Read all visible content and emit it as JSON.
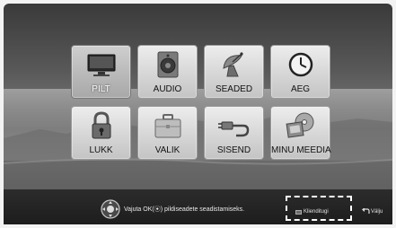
{
  "menu": {
    "tiles": [
      {
        "label": "PILT",
        "icon": "tv-icon",
        "selected": true
      },
      {
        "label": "AUDIO",
        "icon": "speaker-icon",
        "selected": false
      },
      {
        "label": "SEADED",
        "icon": "satellite-dish-icon",
        "selected": false
      },
      {
        "label": "AEG",
        "icon": "clock-icon",
        "selected": false
      },
      {
        "label": "LUKK",
        "icon": "padlock-icon",
        "selected": false
      },
      {
        "label": "VALIK",
        "icon": "briefcase-icon",
        "selected": false
      },
      {
        "label": "SISEND",
        "icon": "input-plug-icon",
        "selected": false
      },
      {
        "label": "MINU MEEDIA",
        "icon": "media-icon",
        "selected": false
      }
    ]
  },
  "footer": {
    "hint": "Vajuta OK(⦿) pildiseadete seadistamiseks.",
    "service": "Klienditugi",
    "exit": "Välju"
  }
}
